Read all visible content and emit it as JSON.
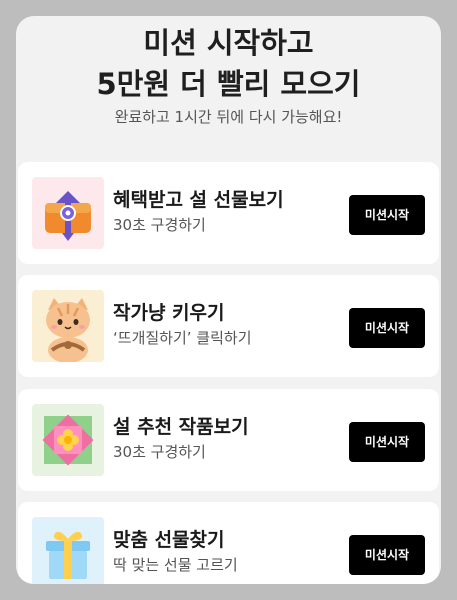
{
  "header": {
    "title_line1": "미션 시작하고",
    "title_line2": "5만원 더 빨리 모으기",
    "subtitle": "완료하고 1시간 뒤에 다시 가능해요!"
  },
  "missions": [
    {
      "title": "혜택받고 설 선물보기",
      "desc": "30초 구경하기",
      "button_label": "미션시작",
      "icon": "gift-box-icon",
      "thumb_bg": "#fde8ec"
    },
    {
      "title": "작가냥 키우기",
      "desc": "‘뜨개질하기’ 클릭하기",
      "button_label": "미션시작",
      "icon": "cat-icon",
      "thumb_bg": "#fbefd3"
    },
    {
      "title": "설 추천 작품보기",
      "desc": "30초 구경하기",
      "button_label": "미션시작",
      "icon": "flower-tile-icon",
      "thumb_bg": "#e8f2e0"
    },
    {
      "title": "맞춤 선물찾기",
      "desc": "딱 맞는 선물 고르기",
      "button_label": "미션시작",
      "icon": "present-icon",
      "thumb_bg": "#dff1fb"
    }
  ],
  "colors": {
    "overlay": "#bdbdbd",
    "sheet": "#f2f2f2",
    "card": "#ffffff",
    "button": "#000000",
    "button_text": "#ffffff"
  }
}
